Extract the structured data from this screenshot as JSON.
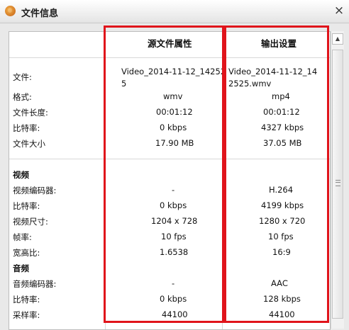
{
  "window": {
    "title": "文件信息",
    "close_glyph": "×"
  },
  "columns": {
    "source": "源文件属性",
    "output": "输出设置"
  },
  "general": {
    "file": {
      "label": "文件:",
      "source": "Video_2014-11-12_142525",
      "output": "Video_2014-11-12_142525.wmv"
    },
    "format": {
      "label": "格式:",
      "source": "wmv",
      "output": "mp4"
    },
    "duration": {
      "label": "文件长度:",
      "source": "00:01:12",
      "output": "00:01:12"
    },
    "bitrate": {
      "label": "比特率:",
      "source": "0 kbps",
      "output": "4327 kbps"
    },
    "size": {
      "label": "文件大小",
      "source": "17.90 MB",
      "output": "37.05 MB"
    }
  },
  "video": {
    "heading": "视频",
    "codec": {
      "label": "视频编码器:",
      "source": "-",
      "output": "H.264"
    },
    "bitrate": {
      "label": "比特率:",
      "source": "0 kbps",
      "output": "4199 kbps"
    },
    "dimensions": {
      "label": "视频尺寸:",
      "source": "1204 x 728",
      "output": "1280 x 720"
    },
    "framerate": {
      "label": "帧率:",
      "source": "10 fps",
      "output": "10 fps"
    },
    "aspect": {
      "label": "宽高比:",
      "source": "1.6538",
      "output": "16:9"
    }
  },
  "audio": {
    "heading": "音频",
    "codec": {
      "label": "音频编码器:",
      "source": "-",
      "output": "AAC"
    },
    "bitrate": {
      "label": "比特率:",
      "source": "0 kbps",
      "output": "128 kbps"
    },
    "samplerate": {
      "label": "采样率:",
      "source": "44100",
      "output": "44100"
    }
  },
  "colors": {
    "highlight": "#e0141b"
  },
  "icons": {
    "app": "app-logo-icon",
    "close": "close-icon",
    "scroll_up": "scroll-up-icon",
    "scroll_down": "scroll-down-icon"
  }
}
